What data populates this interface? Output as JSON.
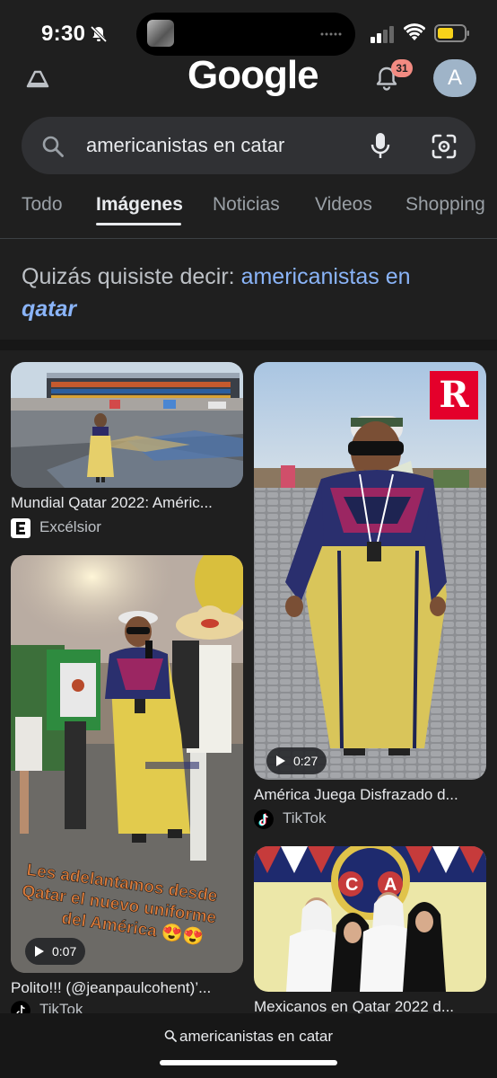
{
  "status_bar": {
    "time": "9:30",
    "icons": [
      "bell-slash-icon",
      "signal-icon",
      "wifi-icon",
      "battery-icon"
    ],
    "battery_color": "#f7d21a"
  },
  "header": {
    "logo": "Google",
    "notifications_count": "31",
    "avatar_letter": "A"
  },
  "search": {
    "query": "americanistas en catar"
  },
  "tabs": [
    {
      "label": "Todo",
      "active": false
    },
    {
      "label": "Imágenes",
      "active": true
    },
    {
      "label": "Noticias",
      "active": false
    },
    {
      "label": "Videos",
      "active": false
    },
    {
      "label": "Shopping",
      "active": false
    }
  ],
  "did_you_mean": {
    "prefix": "Quizás quisiste decir:",
    "suggestion_plain": "americanistas en",
    "suggestion_bold": "qatar"
  },
  "results": [
    {
      "title": "Mundial Qatar 2022: Améric...",
      "source": "Excélsior",
      "source_icon": "excelsior-e-icon",
      "duration": ""
    },
    {
      "title": "América Juega Disfrazado d...",
      "source": "TikTok",
      "source_icon": "tiktok-icon",
      "duration": "0:27"
    },
    {
      "title": "Polito!!! (@jeanpaulcohent)’...",
      "source": "TikTok",
      "source_icon": "tiktok-icon",
      "duration": "0:07",
      "overlay_text": "Les adelantamos desde Qatar el nuevo uniforme del América 😍😍"
    },
    {
      "title": "Mexicanos en Qatar 2022 d...",
      "source": "",
      "source_icon": "",
      "duration": ""
    }
  ],
  "bottom_bar": {
    "query": "americanistas en catar"
  },
  "colors": {
    "background": "#1f1f1f",
    "surface": "#303134",
    "link": "#8ab4f8",
    "text_primary": "#e8eaed",
    "text_secondary": "#9aa0a6"
  }
}
